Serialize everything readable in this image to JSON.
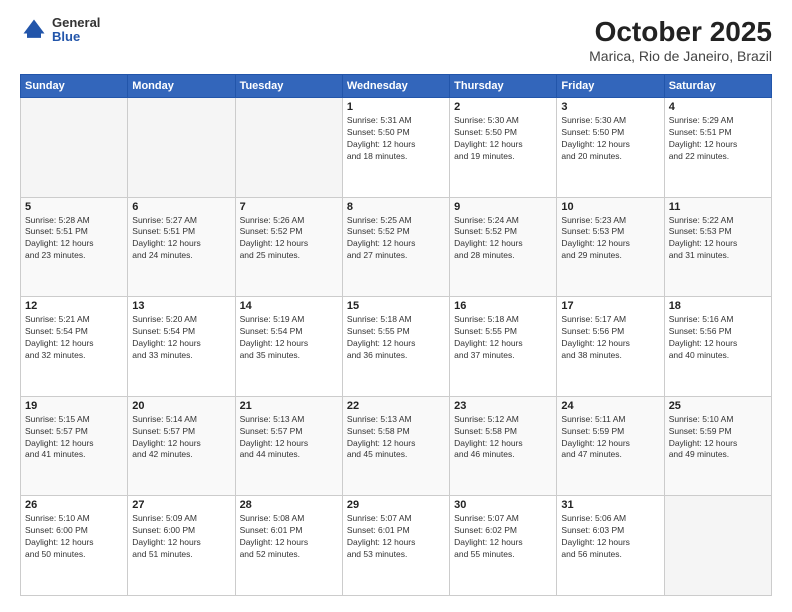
{
  "header": {
    "logo": {
      "general": "General",
      "blue": "Blue"
    },
    "title": "October 2025",
    "location": "Marica, Rio de Janeiro, Brazil"
  },
  "weekdays": [
    "Sunday",
    "Monday",
    "Tuesday",
    "Wednesday",
    "Thursday",
    "Friday",
    "Saturday"
  ],
  "weeks": [
    [
      {
        "day": "",
        "info": ""
      },
      {
        "day": "",
        "info": ""
      },
      {
        "day": "",
        "info": ""
      },
      {
        "day": "1",
        "info": "Sunrise: 5:31 AM\nSunset: 5:50 PM\nDaylight: 12 hours\nand 18 minutes."
      },
      {
        "day": "2",
        "info": "Sunrise: 5:30 AM\nSunset: 5:50 PM\nDaylight: 12 hours\nand 19 minutes."
      },
      {
        "day": "3",
        "info": "Sunrise: 5:30 AM\nSunset: 5:50 PM\nDaylight: 12 hours\nand 20 minutes."
      },
      {
        "day": "4",
        "info": "Sunrise: 5:29 AM\nSunset: 5:51 PM\nDaylight: 12 hours\nand 22 minutes."
      }
    ],
    [
      {
        "day": "5",
        "info": "Sunrise: 5:28 AM\nSunset: 5:51 PM\nDaylight: 12 hours\nand 23 minutes."
      },
      {
        "day": "6",
        "info": "Sunrise: 5:27 AM\nSunset: 5:51 PM\nDaylight: 12 hours\nand 24 minutes."
      },
      {
        "day": "7",
        "info": "Sunrise: 5:26 AM\nSunset: 5:52 PM\nDaylight: 12 hours\nand 25 minutes."
      },
      {
        "day": "8",
        "info": "Sunrise: 5:25 AM\nSunset: 5:52 PM\nDaylight: 12 hours\nand 27 minutes."
      },
      {
        "day": "9",
        "info": "Sunrise: 5:24 AM\nSunset: 5:52 PM\nDaylight: 12 hours\nand 28 minutes."
      },
      {
        "day": "10",
        "info": "Sunrise: 5:23 AM\nSunset: 5:53 PM\nDaylight: 12 hours\nand 29 minutes."
      },
      {
        "day": "11",
        "info": "Sunrise: 5:22 AM\nSunset: 5:53 PM\nDaylight: 12 hours\nand 31 minutes."
      }
    ],
    [
      {
        "day": "12",
        "info": "Sunrise: 5:21 AM\nSunset: 5:54 PM\nDaylight: 12 hours\nand 32 minutes."
      },
      {
        "day": "13",
        "info": "Sunrise: 5:20 AM\nSunset: 5:54 PM\nDaylight: 12 hours\nand 33 minutes."
      },
      {
        "day": "14",
        "info": "Sunrise: 5:19 AM\nSunset: 5:54 PM\nDaylight: 12 hours\nand 35 minutes."
      },
      {
        "day": "15",
        "info": "Sunrise: 5:18 AM\nSunset: 5:55 PM\nDaylight: 12 hours\nand 36 minutes."
      },
      {
        "day": "16",
        "info": "Sunrise: 5:18 AM\nSunset: 5:55 PM\nDaylight: 12 hours\nand 37 minutes."
      },
      {
        "day": "17",
        "info": "Sunrise: 5:17 AM\nSunset: 5:56 PM\nDaylight: 12 hours\nand 38 minutes."
      },
      {
        "day": "18",
        "info": "Sunrise: 5:16 AM\nSunset: 5:56 PM\nDaylight: 12 hours\nand 40 minutes."
      }
    ],
    [
      {
        "day": "19",
        "info": "Sunrise: 5:15 AM\nSunset: 5:57 PM\nDaylight: 12 hours\nand 41 minutes."
      },
      {
        "day": "20",
        "info": "Sunrise: 5:14 AM\nSunset: 5:57 PM\nDaylight: 12 hours\nand 42 minutes."
      },
      {
        "day": "21",
        "info": "Sunrise: 5:13 AM\nSunset: 5:57 PM\nDaylight: 12 hours\nand 44 minutes."
      },
      {
        "day": "22",
        "info": "Sunrise: 5:13 AM\nSunset: 5:58 PM\nDaylight: 12 hours\nand 45 minutes."
      },
      {
        "day": "23",
        "info": "Sunrise: 5:12 AM\nSunset: 5:58 PM\nDaylight: 12 hours\nand 46 minutes."
      },
      {
        "day": "24",
        "info": "Sunrise: 5:11 AM\nSunset: 5:59 PM\nDaylight: 12 hours\nand 47 minutes."
      },
      {
        "day": "25",
        "info": "Sunrise: 5:10 AM\nSunset: 5:59 PM\nDaylight: 12 hours\nand 49 minutes."
      }
    ],
    [
      {
        "day": "26",
        "info": "Sunrise: 5:10 AM\nSunset: 6:00 PM\nDaylight: 12 hours\nand 50 minutes."
      },
      {
        "day": "27",
        "info": "Sunrise: 5:09 AM\nSunset: 6:00 PM\nDaylight: 12 hours\nand 51 minutes."
      },
      {
        "day": "28",
        "info": "Sunrise: 5:08 AM\nSunset: 6:01 PM\nDaylight: 12 hours\nand 52 minutes."
      },
      {
        "day": "29",
        "info": "Sunrise: 5:07 AM\nSunset: 6:01 PM\nDaylight: 12 hours\nand 53 minutes."
      },
      {
        "day": "30",
        "info": "Sunrise: 5:07 AM\nSunset: 6:02 PM\nDaylight: 12 hours\nand 55 minutes."
      },
      {
        "day": "31",
        "info": "Sunrise: 5:06 AM\nSunset: 6:03 PM\nDaylight: 12 hours\nand 56 minutes."
      },
      {
        "day": "",
        "info": ""
      }
    ]
  ]
}
